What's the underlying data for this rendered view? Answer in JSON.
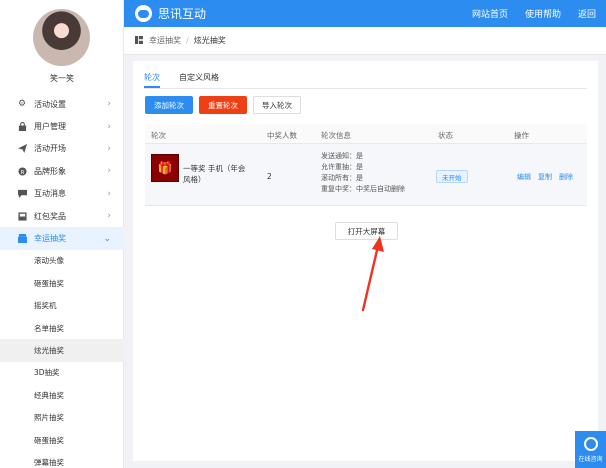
{
  "header": {
    "brand": "思讯互动",
    "nav": [
      "网站首页",
      "使用帮助",
      "返回"
    ]
  },
  "sidebar": {
    "username": "笑一笑",
    "menu": [
      {
        "label": "活动设置",
        "icon": "gear-icon"
      },
      {
        "label": "用户管理",
        "icon": "user-icon"
      },
      {
        "label": "活动开场",
        "icon": "send-icon"
      },
      {
        "label": "品牌形象",
        "icon": "brand-icon"
      },
      {
        "label": "互动消息",
        "icon": "message-icon"
      },
      {
        "label": "红包奖品",
        "icon": "gift-icon"
      },
      {
        "label": "幸运抽奖",
        "icon": "lottery-icon"
      }
    ],
    "submenu": [
      "滚动头像",
      "砸蛋抽奖",
      "摇奖机",
      "名单抽奖",
      "炫光抽奖",
      "3D抽奖",
      "经典抽奖",
      "照片抽奖",
      "砸蛋抽奖",
      "弹幕抽奖"
    ]
  },
  "breadcrumb": {
    "parent": "幸运抽奖",
    "current": "炫光抽奖"
  },
  "tabs": [
    "轮次",
    "自定义风格"
  ],
  "buttons": {
    "add": "添加轮次",
    "reset": "重置轮次",
    "import": "导入轮次"
  },
  "table": {
    "headers": [
      "轮次",
      "中奖人数",
      "轮次信息",
      "状态",
      "操作"
    ],
    "rows": [
      {
        "prize": "一等奖 手机（年会风格）",
        "winners": "2",
        "info": [
          "发送通知：是",
          "允许重抽：是",
          "滚动所有：是",
          "重复中奖：中奖后自动删除"
        ],
        "status": "未开始",
        "ops": [
          "编辑",
          "复制",
          "删除"
        ]
      }
    ]
  },
  "bigscreen": "打开大屏幕",
  "online": "在线咨询",
  "colors": {
    "primary": "#2d8cf0",
    "danger": "#ed4014",
    "annotation_arrow": "#ee3322"
  }
}
